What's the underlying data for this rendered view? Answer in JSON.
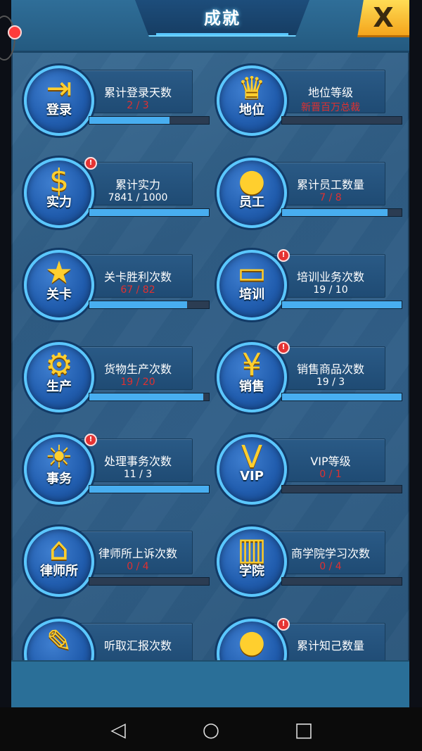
{
  "dialog": {
    "title": "成就",
    "close_label": "X"
  },
  "achievements": [
    {
      "id": "login",
      "badge": "登录",
      "glyph": "⇥",
      "name": "累计登录天数",
      "value": "2 / 3",
      "value_color": "red",
      "progress": 0.67,
      "alert": false
    },
    {
      "id": "status",
      "badge": "地位",
      "glyph": "♛",
      "name": "地位等级",
      "value": "新晋百万总裁",
      "value_color": "red",
      "progress": 0.0,
      "alert": false
    },
    {
      "id": "power",
      "badge": "实力",
      "glyph": "$",
      "name": "累计实力",
      "value": "7841 / 1000",
      "value_color": "white",
      "progress": 1.0,
      "alert": true
    },
    {
      "id": "staff",
      "badge": "员工",
      "glyph": "●",
      "name": "累计员工数量",
      "value": "7 / 8",
      "value_color": "red",
      "progress": 0.88,
      "alert": false
    },
    {
      "id": "level",
      "badge": "关卡",
      "glyph": "★",
      "name": "关卡胜利次数",
      "value": "67 / 82",
      "value_color": "red",
      "progress": 0.82,
      "alert": false
    },
    {
      "id": "train",
      "badge": "培训",
      "glyph": "▭",
      "name": "培训业务次数",
      "value": "19 / 10",
      "value_color": "white",
      "progress": 1.0,
      "alert": true
    },
    {
      "id": "produce",
      "badge": "生产",
      "glyph": "⚙",
      "name": "货物生产次数",
      "value": "19 / 20",
      "value_color": "red",
      "progress": 0.95,
      "alert": false
    },
    {
      "id": "sales",
      "badge": "销售",
      "glyph": "¥",
      "name": "销售商品次数",
      "value": "19 / 3",
      "value_color": "white",
      "progress": 1.0,
      "alert": true
    },
    {
      "id": "affairs",
      "badge": "事务",
      "glyph": "☀",
      "name": "处理事务次数",
      "value": "11 / 3",
      "value_color": "white",
      "progress": 1.0,
      "alert": true
    },
    {
      "id": "vip",
      "badge": "VIP",
      "glyph": "V",
      "name": "VIP等级",
      "value": "0 / 1",
      "value_color": "red",
      "progress": 0.0,
      "alert": false
    },
    {
      "id": "lawyer",
      "badge": "律师所",
      "glyph": "⌂",
      "name": "律师所上诉次数",
      "value": "0 / 4",
      "value_color": "red",
      "progress": 0.0,
      "alert": false
    },
    {
      "id": "school",
      "badge": "学院",
      "glyph": "▥",
      "name": "商学院学习次数",
      "value": "0 / 4",
      "value_color": "red",
      "progress": 0.0,
      "alert": false
    },
    {
      "id": "report",
      "badge": "",
      "glyph": "✎",
      "name": "听取汇报次数",
      "value": "",
      "value_color": "red",
      "progress": 0.0,
      "alert": false
    },
    {
      "id": "friend",
      "badge": "",
      "glyph": "●",
      "name": "累计知己数量",
      "value": "",
      "value_color": "white",
      "progress": 0.0,
      "alert": true
    }
  ],
  "colors": {
    "alert": "#e63333",
    "progress": "#48aef0",
    "red_value": "#e03030"
  },
  "navbar": {
    "back": "◁",
    "home": "○",
    "recent": "□"
  }
}
